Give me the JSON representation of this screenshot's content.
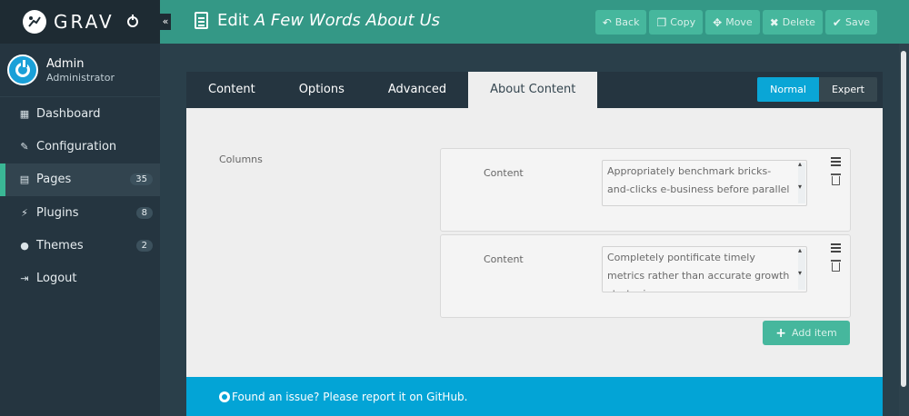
{
  "brand": {
    "name": "GRAV"
  },
  "user": {
    "name": "Admin",
    "role": "Administrator"
  },
  "nav": [
    {
      "label": "Dashboard",
      "icon": "grid-icon"
    },
    {
      "label": "Configuration",
      "icon": "wrench-icon"
    },
    {
      "label": "Pages",
      "icon": "page-icon",
      "badge": "35",
      "active": true
    },
    {
      "label": "Plugins",
      "icon": "plug-icon",
      "badge": "8"
    },
    {
      "label": "Themes",
      "icon": "tint-icon",
      "badge": "2"
    },
    {
      "label": "Logout",
      "icon": "logout-icon"
    }
  ],
  "header": {
    "title_prefix": "Edit",
    "title_page": "A Few Words About Us",
    "actions": {
      "back": "Back",
      "copy": "Copy",
      "move": "Move",
      "delete": "Delete",
      "save": "Save"
    }
  },
  "tabs": [
    "Content",
    "Options",
    "Advanced",
    "About Content"
  ],
  "active_tab": "About Content",
  "mode": {
    "normal": "Normal",
    "expert": "Expert",
    "selected": "Normal"
  },
  "form": {
    "columns_label": "Columns",
    "items": [
      {
        "label": "Content",
        "value": "Appropriately benchmark bricks-and-clicks e-business before parallel"
      },
      {
        "label": "Content",
        "value": "Completely pontificate timely metrics rather than accurate growth strategies."
      }
    ],
    "add_item": "Add item"
  },
  "footer": {
    "text": "Found an issue? Please report it on GitHub."
  },
  "colors": {
    "teal": "#349886",
    "button": "#46b79d",
    "sidebar": "#253540",
    "blue": "#03a4d6"
  }
}
